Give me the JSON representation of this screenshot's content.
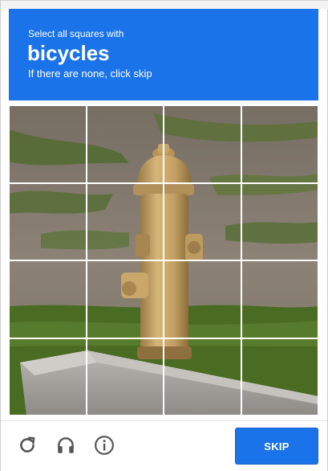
{
  "captcha": {
    "instruction_prefix": "Select all squares with",
    "target_object": "bicycles",
    "instruction_suffix": "If there are none, click skip",
    "grid": {
      "rows": 4,
      "columns": 4,
      "image_content": "fire-hydrant-on-grass"
    },
    "footer": {
      "reload_icon": "reload-icon",
      "audio_icon": "headphones-icon",
      "info_icon": "info-icon",
      "skip_label": "SKIP"
    },
    "colors": {
      "accent": "#1a73e8",
      "grid_lines": "#ffffff"
    }
  }
}
